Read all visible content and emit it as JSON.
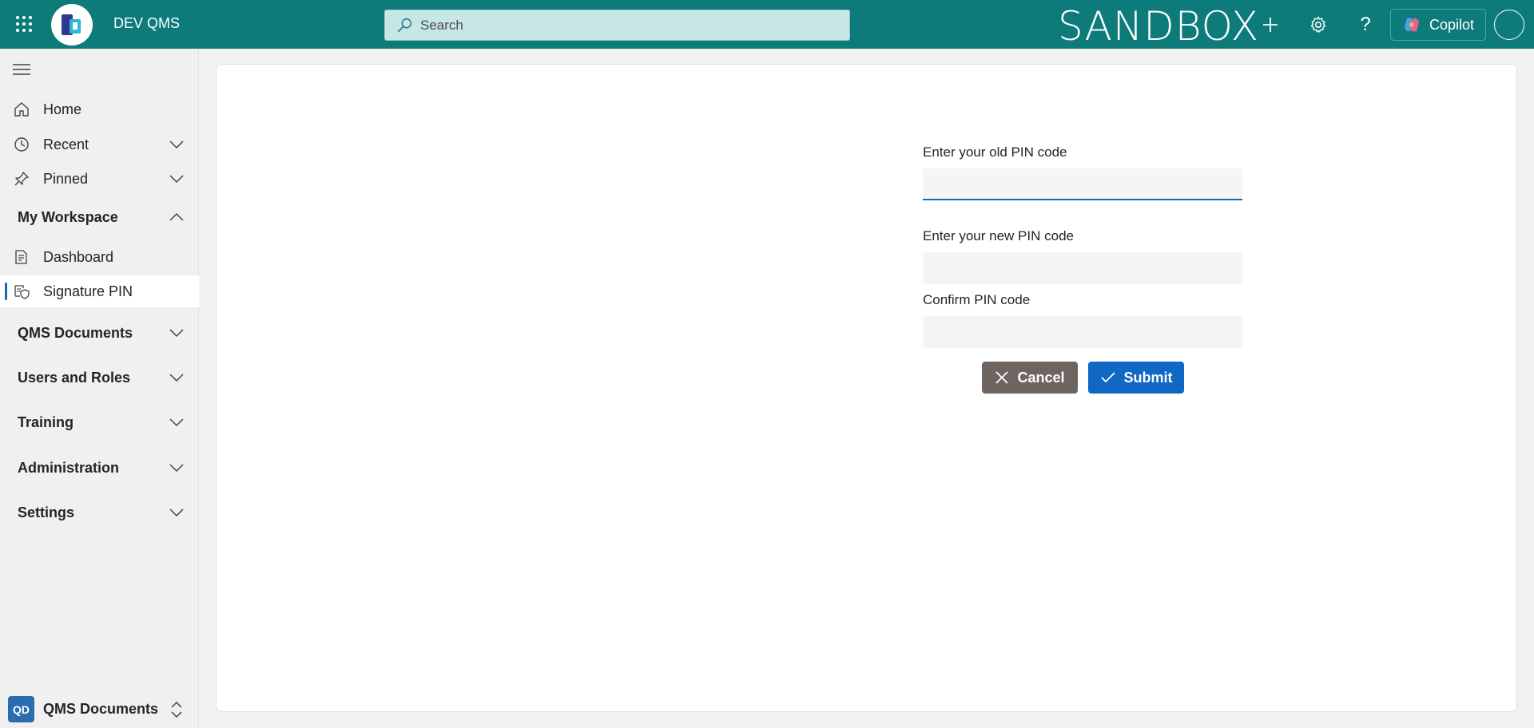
{
  "header": {
    "app_name": "DEV QMS",
    "search_placeholder": "Search",
    "environment_label": "SANDBOX",
    "copilot_label": "Copilot"
  },
  "sidebar": {
    "items": [
      {
        "label": "Home",
        "icon": "home-icon"
      },
      {
        "label": "Recent",
        "icon": "clock-icon"
      },
      {
        "label": "Pinned",
        "icon": "pin-icon"
      }
    ],
    "workspace_section": "My Workspace",
    "workspace_items": [
      {
        "label": "Dashboard",
        "icon": "dashboard-icon"
      },
      {
        "label": "Signature PIN",
        "icon": "shield-icon",
        "selected": true
      }
    ],
    "sections": [
      "QMS Documents",
      "Users and Roles",
      "Training",
      "Administration",
      "Settings"
    ],
    "switcher": {
      "badge": "QD",
      "label": "QMS Documents"
    }
  },
  "form": {
    "old_pin_label": "Enter your old PIN code",
    "new_pin_label": "Enter your new PIN code",
    "confirm_pin_label": "Confirm PIN code",
    "cancel_label": "Cancel",
    "submit_label": "Submit"
  },
  "colors": {
    "header_bg": "#0e7b7b",
    "accent": "#0f6cbd",
    "cancel_bg": "#6e6460",
    "submit_bg": "#1167c4"
  }
}
